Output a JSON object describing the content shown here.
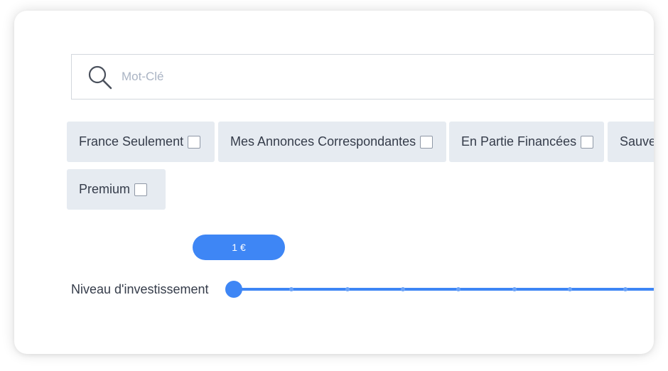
{
  "search": {
    "placeholder": "Mot-Clé",
    "icon": "search-icon"
  },
  "filters": {
    "items": [
      {
        "label": "France Seulement",
        "checked": false
      },
      {
        "label": "Mes Annonces Correspondantes",
        "checked": false
      },
      {
        "label": "En Partie Financées",
        "checked": false
      },
      {
        "label": "Sauve",
        "checked": false
      },
      {
        "label": "Premium",
        "checked": false
      }
    ]
  },
  "investment": {
    "label": "Niveau d'investissement",
    "value_display": "1 €",
    "slider_position": 0
  },
  "colors": {
    "accent": "#3e86f5",
    "chip_background": "#e6ebf1",
    "text": "#353c4a",
    "placeholder": "#aab4c4"
  }
}
